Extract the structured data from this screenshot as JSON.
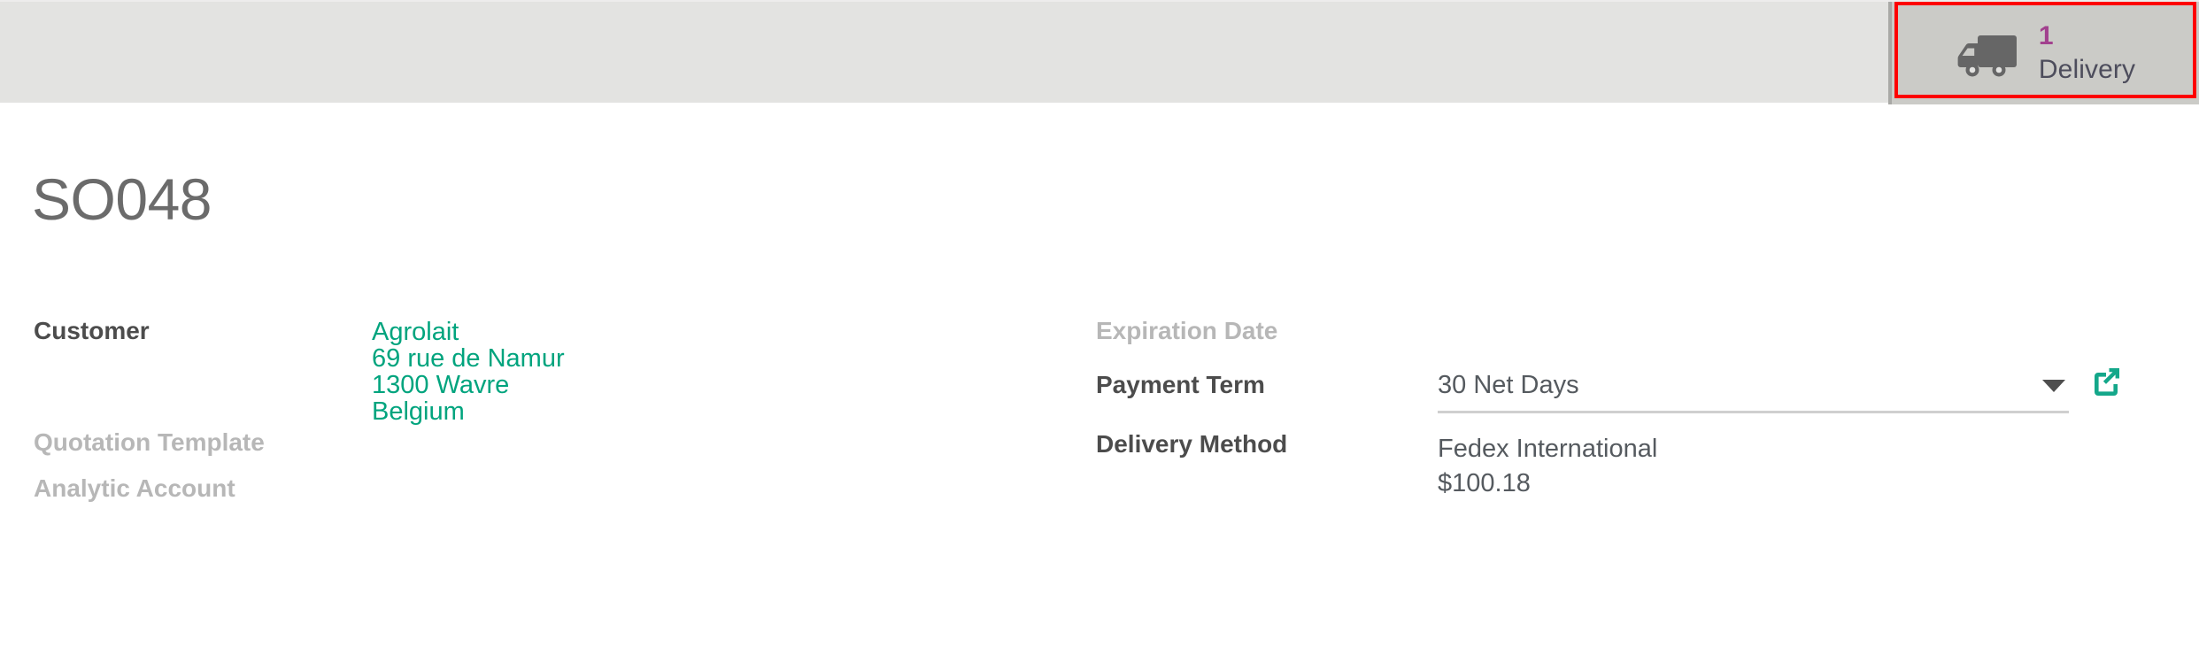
{
  "statbar": {
    "background_color": "#e3e3e1",
    "button": {
      "icon": "truck-icon",
      "count": "1",
      "label": "Delivery",
      "count_color": "#a2418e",
      "label_color": "#4d4d5c",
      "highlight_color": "#fe0000"
    }
  },
  "record": {
    "title": "SO048"
  },
  "form": {
    "left_column": [
      {
        "label": "Customer",
        "state": "filled",
        "value_type": "link_block",
        "lines": [
          "Agrolait",
          "69 rue de Namur",
          "1300 Wavre",
          "Belgium"
        ],
        "link_color": "#00a47e"
      },
      {
        "label": "Quotation Template",
        "state": "empty",
        "value_type": "none",
        "lines": []
      },
      {
        "label": "Analytic Account",
        "state": "empty",
        "value_type": "none",
        "lines": []
      }
    ],
    "right_column": [
      {
        "label": "Expiration Date",
        "state": "empty",
        "value_type": "none",
        "value": ""
      },
      {
        "label": "Payment Term",
        "state": "filled",
        "value_type": "select",
        "value": "30 Net Days",
        "caret_icon": "chevron-down-icon",
        "external_link_icon": "external-link-icon"
      },
      {
        "label": "Delivery Method",
        "state": "filled",
        "value_type": "stacked_text",
        "lines": [
          "Fedex International",
          "$100.18"
        ]
      }
    ]
  },
  "colors": {
    "accent_teal": "#00a47e",
    "brand_purple": "#a2418e",
    "text_dark": "#4c4c4c",
    "text_muted": "#b7b7b7",
    "title_gray": "#6b6b6b"
  }
}
